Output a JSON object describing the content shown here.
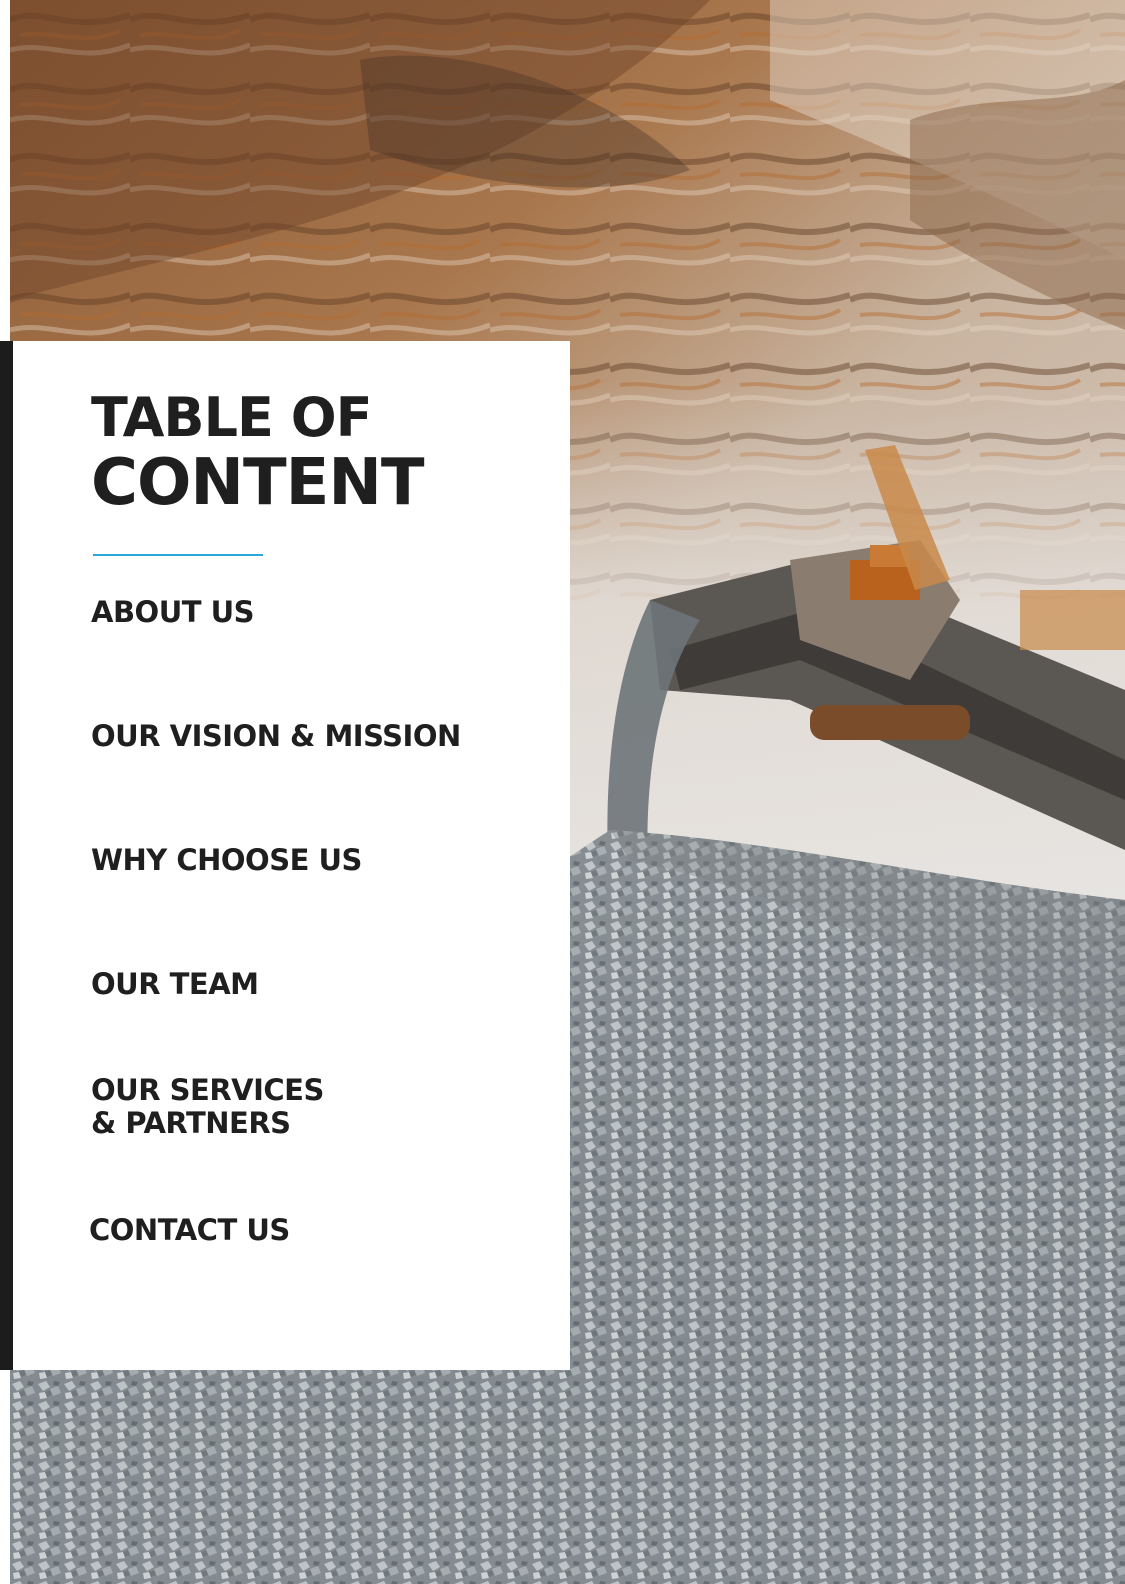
{
  "toc": {
    "title_line1": "TABLE OF",
    "title_line2": "CONTENT",
    "items": [
      {
        "label": "ABOUT US"
      },
      {
        "label": "OUR VISION & MISSION"
      },
      {
        "label": "WHY CHOOSE US"
      },
      {
        "label": "OUR TEAM"
      },
      {
        "label_line1": "OUR SERVICES",
        "label_line2": "& PARTNERS"
      },
      {
        "label": "CONTACT US"
      }
    ]
  },
  "colors": {
    "accent": "#2aa7d6",
    "text": "#1f1f1f",
    "side_bar": "#1c1c1c"
  },
  "photo": {
    "icon": "quarry-conveyor-gravel-photo"
  }
}
